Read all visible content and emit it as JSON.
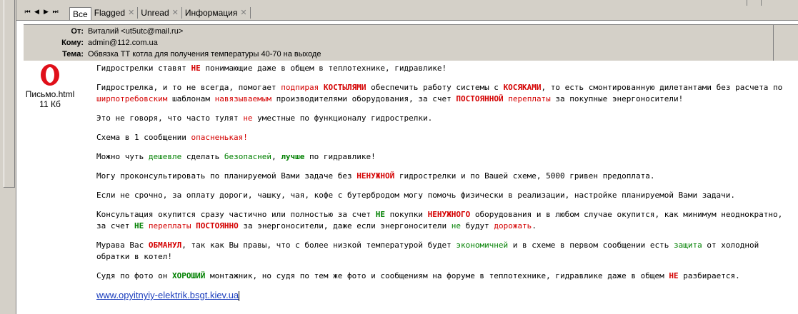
{
  "nav": {
    "first": "⏮",
    "prev": "◀",
    "next": "▶",
    "last": "⏭"
  },
  "tabs": [
    {
      "label": "Все",
      "active": true,
      "closable": false
    },
    {
      "label": "Flagged",
      "active": false,
      "closable": true
    },
    {
      "label": "Unread",
      "active": false,
      "closable": true
    },
    {
      "label": "Информация",
      "active": false,
      "closable": true
    }
  ],
  "header": {
    "from_label": "От:",
    "from_value": "Виталий <ut5utc@mail.ru>",
    "to_label": "Кому:",
    "to_value": "admin@112.com.ua",
    "subject_label": "Тема:",
    "subject_value": "Обвязка ТТ котла для получения температуры 40-70 на выходе"
  },
  "attachment": {
    "icon": "opera-icon",
    "filename": "Письмо.html",
    "size": "11 Кб"
  },
  "colors": {
    "red": "#d40000",
    "green": "#008000",
    "link": "#1a3dbd",
    "chrome": "#d4d0c8"
  },
  "message": {
    "paragraphs": [
      [
        {
          "t": "Гидрострелки ставят "
        },
        {
          "t": "НЕ",
          "s": "rb"
        },
        {
          "t": " понимающие даже в общем в теплотехнике, гидравлике!"
        }
      ],
      [
        {
          "t": "Гидрострелка, и то не всегда, помогает "
        },
        {
          "t": "подпирая",
          "s": "r"
        },
        {
          "t": " "
        },
        {
          "t": "КОСТЫЛЯМИ",
          "s": "rb"
        },
        {
          "t": " обеспечить работу системы с "
        },
        {
          "t": "КОСЯКАМИ",
          "s": "rb"
        },
        {
          "t": ", то есть смонтированную дилетантами без расчета по "
        },
        {
          "t": "ширпотребовским",
          "s": "r"
        },
        {
          "t": " шаблонам "
        },
        {
          "t": "навязываемым",
          "s": "r"
        },
        {
          "t": " производителями оборудования, за счет "
        },
        {
          "t": "ПОСТОЯННОЙ",
          "s": "rb"
        },
        {
          "t": " "
        },
        {
          "t": "переплаты",
          "s": "r"
        },
        {
          "t": " за покупные энергоносители!"
        }
      ],
      [
        {
          "t": "Это не говоря, что часто тулят "
        },
        {
          "t": "не",
          "s": "r"
        },
        {
          "t": " уместные по функционалу гидрострелки."
        }
      ],
      [
        {
          "t": "Схема в 1 сообщении "
        },
        {
          "t": "опасненькая!",
          "s": "r"
        }
      ],
      [
        {
          "t": "Можно чуть "
        },
        {
          "t": "дешевле",
          "s": "g"
        },
        {
          "t": " сделать "
        },
        {
          "t": "безопасней",
          "s": "g"
        },
        {
          "t": ", "
        },
        {
          "t": "лучше",
          "s": "gb"
        },
        {
          "t": " по гидравлике!"
        }
      ],
      [
        {
          "t": "Могу проконсультировать по планируемой Вами задаче без "
        },
        {
          "t": "НЕНУЖНОЙ",
          "s": "rb"
        },
        {
          "t": " гидрострелки и по Вашей схеме, 5000 гривен предоплата."
        }
      ],
      [
        {
          "t": "Если не срочно, за оплату дороги, чашку, чая, кофе с бутербродом могу помочь физически в реализации, настройке планируемой Вами задачи."
        }
      ],
      [
        {
          "t": "Консультация окупится сразу частично или полностью за счет "
        },
        {
          "t": "НЕ",
          "s": "gb"
        },
        {
          "t": " покупки "
        },
        {
          "t": "НЕНУЖНОГО",
          "s": "rb"
        },
        {
          "t": " оборудования и в любом случае окупится, как минимум неоднократно, за счет "
        },
        {
          "t": "НЕ",
          "s": "gb"
        },
        {
          "t": " "
        },
        {
          "t": "переплаты",
          "s": "r"
        },
        {
          "t": " "
        },
        {
          "t": "ПОСТОЯННО",
          "s": "rb"
        },
        {
          "t": " за энергоносители, даже если энергоносители "
        },
        {
          "t": "не",
          "s": "g"
        },
        {
          "t": " будут "
        },
        {
          "t": "дорожать",
          "s": "r"
        },
        {
          "t": "."
        }
      ],
      [
        {
          "t": "Мурава Вас "
        },
        {
          "t": "ОБМАНУЛ",
          "s": "rb"
        },
        {
          "t": ", так как Вы правы, что с более низкой температурой будет "
        },
        {
          "t": "экономичней",
          "s": "g"
        },
        {
          "t": " и в схеме в первом сообщении есть "
        },
        {
          "t": "защита",
          "s": "g"
        },
        {
          "t": " от холодной обратки в котел!"
        }
      ],
      [
        {
          "t": "Судя по фото он "
        },
        {
          "t": "ХОРОШИЙ",
          "s": "gb"
        },
        {
          "t": " монтажник, но судя по тем же фото и сообщениям на форуме в теплотехнике, гидравлике даже в общем "
        },
        {
          "t": "НЕ",
          "s": "rb"
        },
        {
          "t": " разбирается."
        }
      ]
    ],
    "link": "www.opyitnyiy-elektrik.bsgt.kiev.ua"
  }
}
